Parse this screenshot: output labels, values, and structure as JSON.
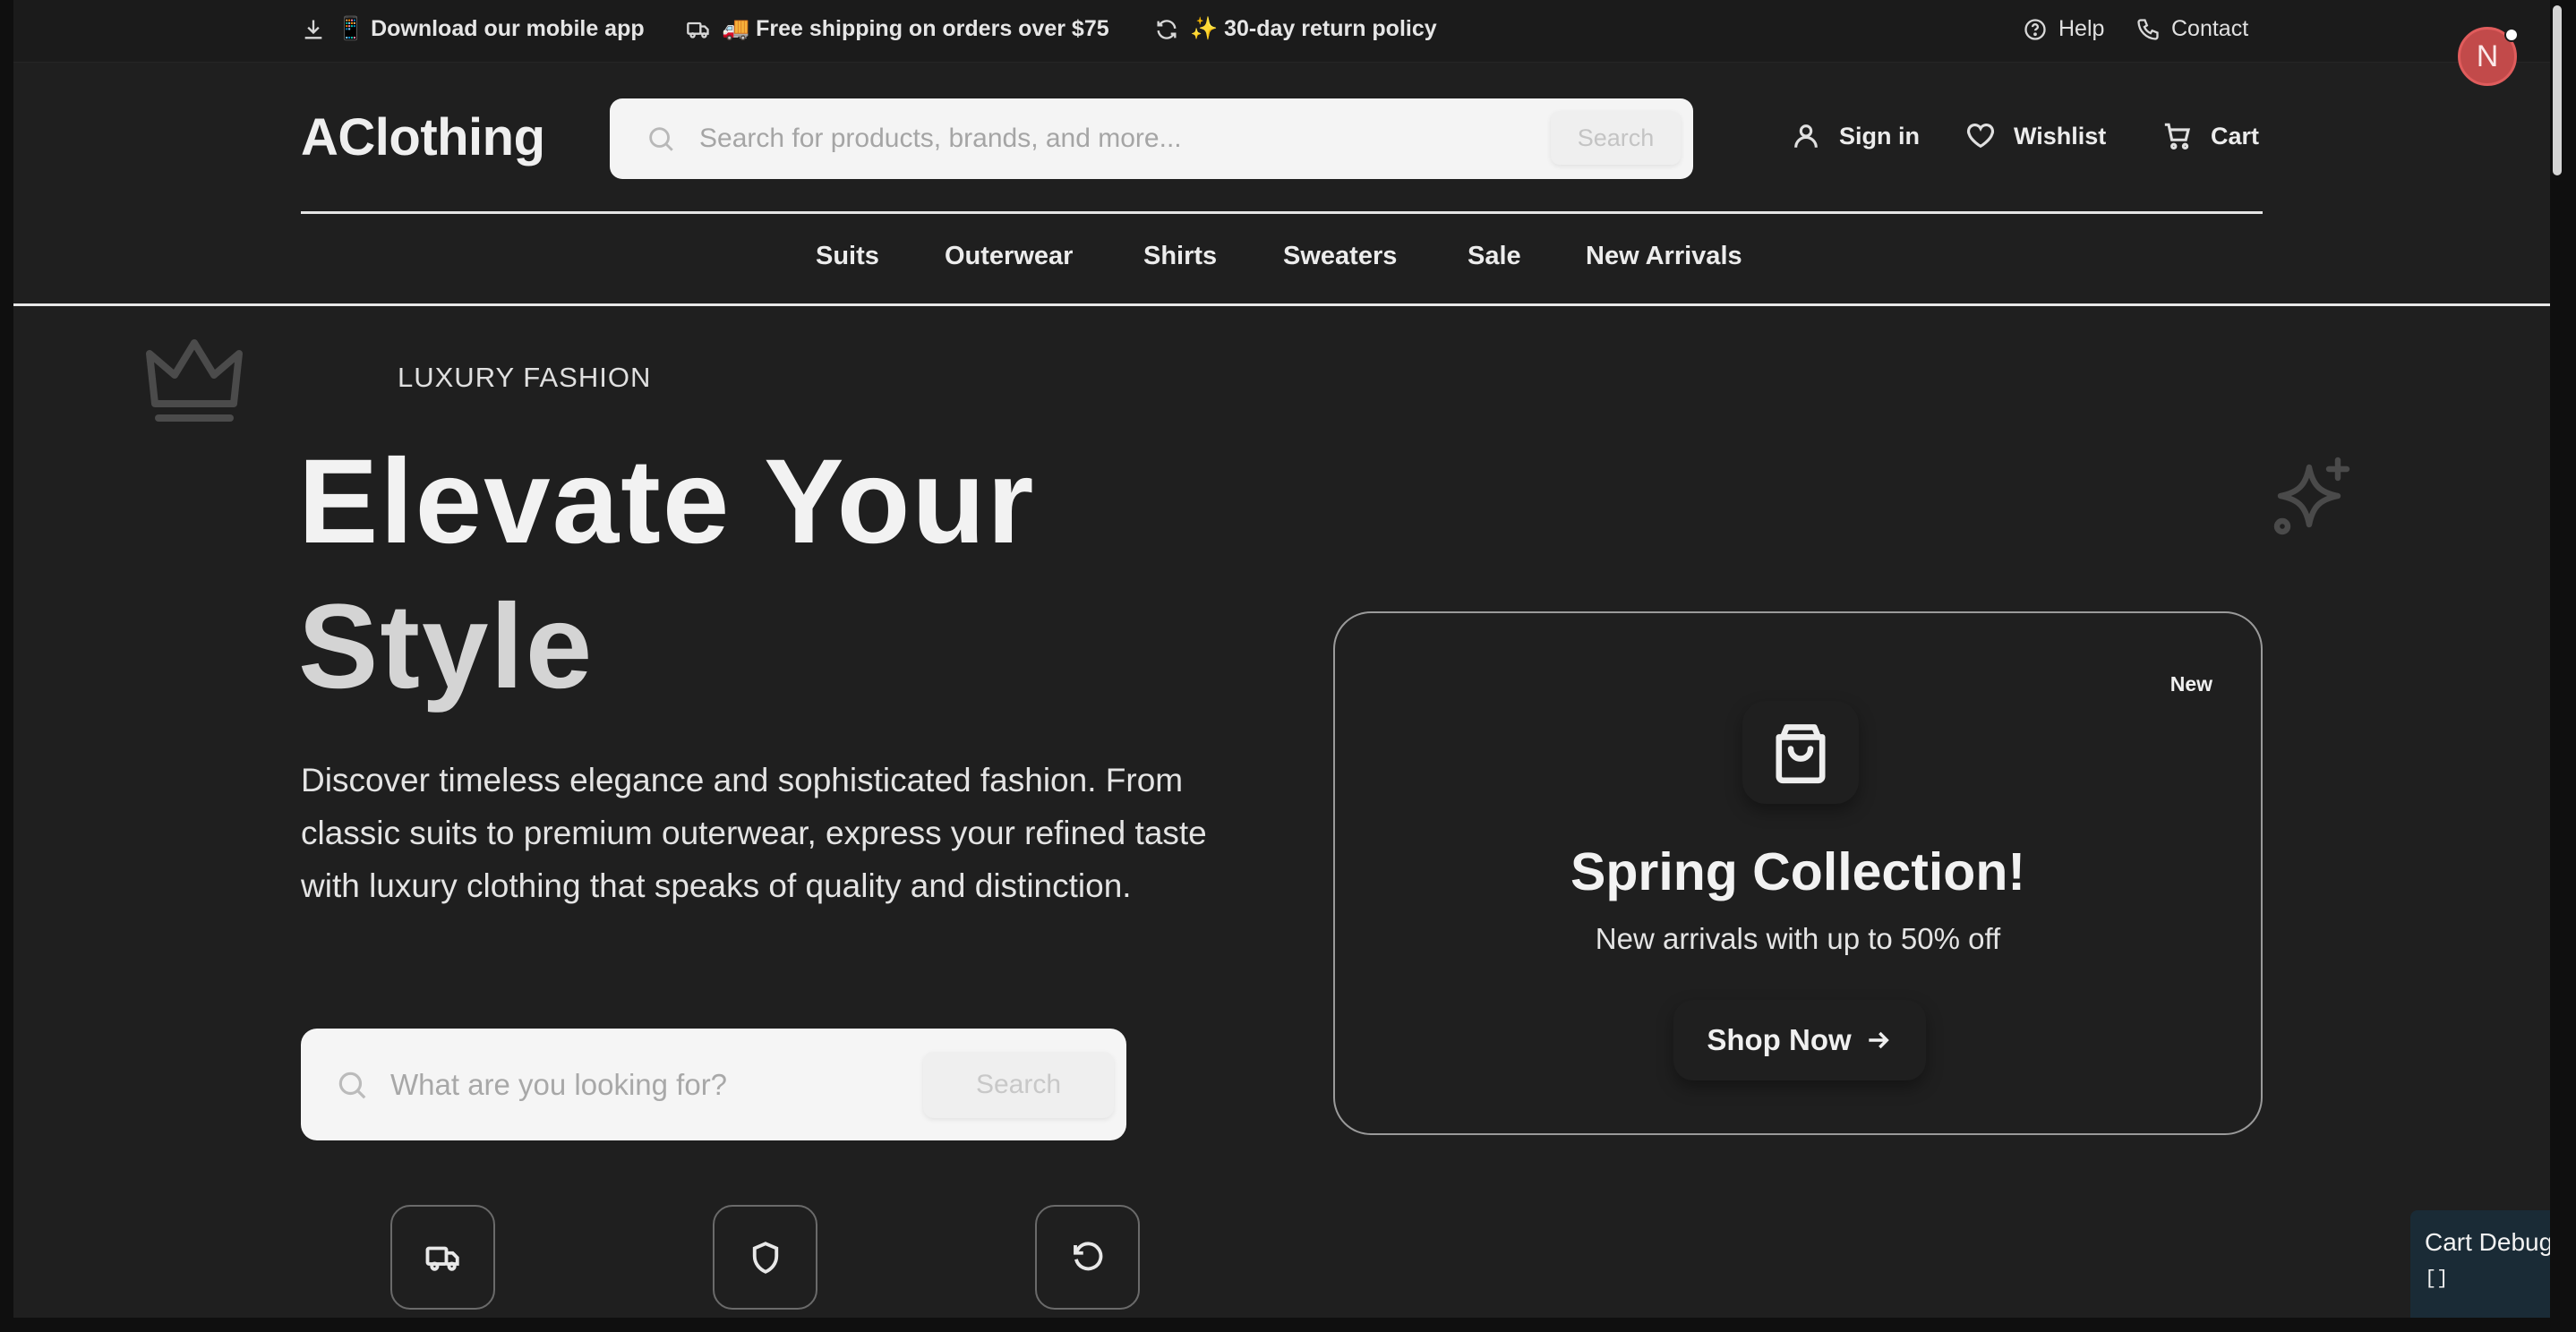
{
  "topbar": {
    "download": "📱 Download our mobile app",
    "shipping": "🚚 Free shipping on orders over $75",
    "returns": "✨ 30-day return policy",
    "help": "Help",
    "contact": "Contact"
  },
  "header": {
    "logo": "AClothing",
    "search_placeholder": "Search for products, brands, and more...",
    "search_button": "Search",
    "sign_in": "Sign in",
    "wishlist": "Wishlist",
    "cart": "Cart"
  },
  "nav": {
    "items": [
      "Suits",
      "Outerwear",
      "Shirts",
      "Sweaters",
      "Sale",
      "New Arrivals"
    ]
  },
  "hero": {
    "eyebrow": "LUXURY FASHION",
    "title_line1": "Elevate Your",
    "title_line2": "Style",
    "description": "Discover timeless elegance and sophisticated fashion. From classic suits to premium outerwear, express your refined taste with luxury clothing that speaks of quality and distinction.",
    "search_placeholder": "What are you looking for?",
    "search_button": "Search"
  },
  "promo": {
    "badge": "New",
    "title": "Spring Collection!",
    "subtitle": "New arrivals with up to 50% off",
    "button": "Shop Now"
  },
  "avatar": {
    "initial": "N",
    "color": "#c24a4a"
  },
  "cart_debug": {
    "title": "Cart Debug",
    "value": "[]"
  },
  "icons": {
    "topbar": [
      "download-icon",
      "truck-icon",
      "refresh-icon",
      "help-circle-icon",
      "phone-icon"
    ],
    "header": [
      "search-icon",
      "user-icon",
      "heart-icon",
      "cart-icon"
    ],
    "hero": [
      "crown-icon",
      "sparkle-icon",
      "search-icon"
    ],
    "features": [
      "truck-icon",
      "shield-icon",
      "rotate-ccw-icon"
    ],
    "promo": [
      "shopping-bag-icon",
      "arrow-right-icon"
    ]
  },
  "colors": {
    "background": "#1f1f1f",
    "text": "#e8e8e8",
    "search_bg": "#f4f4f4",
    "cart_debug_bg": "#1a2b36"
  }
}
